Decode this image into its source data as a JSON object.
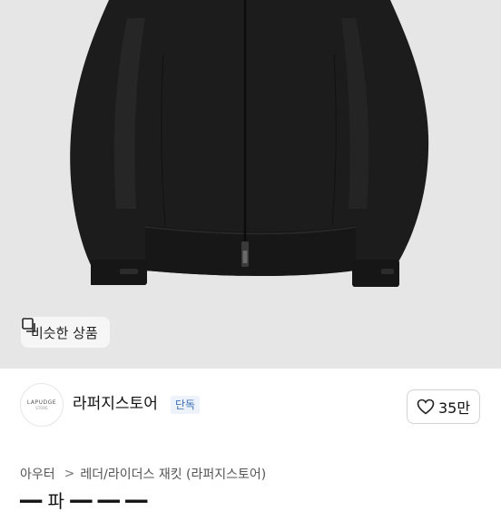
{
  "similar_button": {
    "label": "비슷한 상품",
    "icon": "similar-items-icon"
  },
  "store": {
    "logo_text": "LAPUDGE",
    "logo_sub": "STORE",
    "name": "라퍼지스토어",
    "badge": "단독"
  },
  "like": {
    "count": "35만",
    "icon": "heart-icon"
  },
  "breadcrumb": {
    "category": "아우터",
    "separator": ">",
    "subcategory": "레더/라이더스 재킷 (라퍼지스토어)"
  },
  "product": {
    "title_peek": "━━ 파 ━━ ━━ ━━"
  },
  "colors": {
    "image_bg": "#e7e6e6",
    "badge_bg": "#eef3fb",
    "badge_text": "#3c6fb6"
  }
}
